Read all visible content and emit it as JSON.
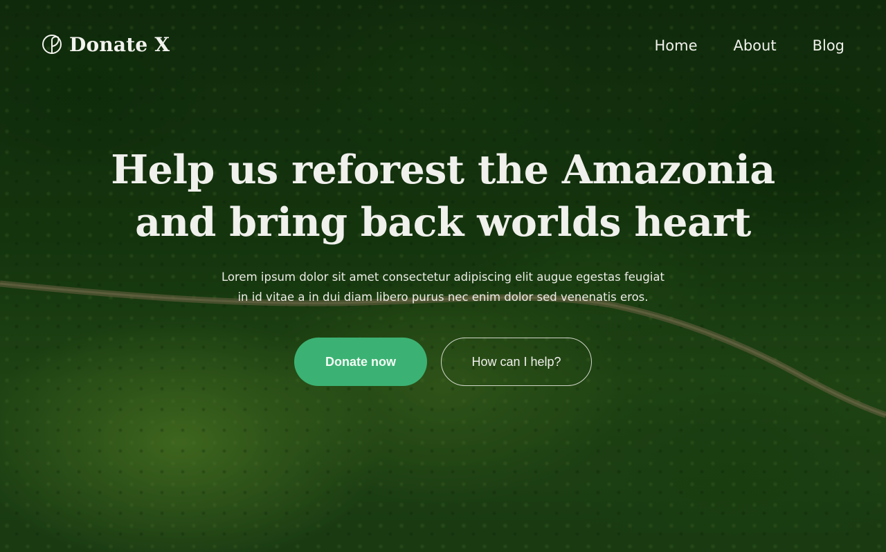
{
  "brand": {
    "name": "Donate X",
    "icon": "leaf-circle-icon"
  },
  "nav": {
    "items": [
      {
        "label": "Home"
      },
      {
        "label": "About"
      },
      {
        "label": "Blog"
      }
    ]
  },
  "hero": {
    "headline_line1": "Help us reforest the Amazonia",
    "headline_line2": "and bring back worlds heart",
    "subtext_line1": "Lorem ipsum dolor sit amet consectetur adipiscing elit augue egestas feugiat",
    "subtext_line2": "in id vitae a in dui diam libero purus nec enim dolor sed venenatis eros.",
    "primary_button": "Donate now",
    "secondary_button": "How can I help?"
  },
  "colors": {
    "accent": "#3bb273",
    "text": "#f0f0ec",
    "background": "#1d4a14"
  }
}
